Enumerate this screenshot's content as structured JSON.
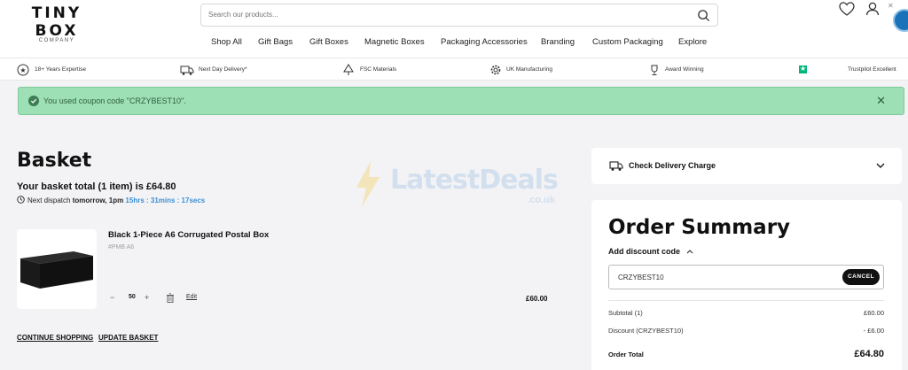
{
  "header": {
    "logo_main": "TINY BOX",
    "logo_sub": "COMPANY",
    "search_placeholder": "Search our products...",
    "nav": [
      "Shop All",
      "Gift Bags",
      "Gift Boxes",
      "Magnetic Boxes",
      "Packaging Accessories",
      "Branding",
      "Custom Packaging",
      "Explore"
    ]
  },
  "usp": [
    "18+ Years Expertise",
    "Next Day Delivery*",
    "FSC Materials",
    "UK Manufacturing",
    "Award Winning",
    "Trustpilot Excellent"
  ],
  "alert": {
    "message": "You used coupon code \"CRZYBEST10\".",
    "close": "✕",
    "color": "#9de0b6"
  },
  "watermark": {
    "brand": "LatestDeals",
    "sub": ".co.uk"
  },
  "basket": {
    "title": "Basket",
    "total_text": "Your basket total (1 item) is £64.80",
    "dispatch_prefix": "Next dispatch",
    "dispatch_when": "tomorrow, 1pm",
    "dispatch_countdown": "15hrs : 31mins : 17secs",
    "item": {
      "name": "Black 1-Piece A6 Corrugated Postal Box",
      "sku": "#PMB A6",
      "quantity": "50",
      "minus": "−",
      "plus": "+",
      "edit": "Edit",
      "price": "£60.00"
    },
    "continue_label": "CONTINUE SHOPPING",
    "update_label": "UPDATE BASKET"
  },
  "delivery": {
    "label": "Check Delivery Charge"
  },
  "summary": {
    "title": "Order Summary",
    "discount_label": "Add discount code",
    "discount_value": "CRZYBEST10",
    "cancel_label": "CANCEL",
    "subtotal_label": "Subtotal (1)",
    "subtotal_value": "£60.00",
    "discount_row_label": "Discount (CRZYBEST10)",
    "discount_row_value": "- £6.00",
    "total_label": "Order Total",
    "total_value": "£64.80"
  }
}
